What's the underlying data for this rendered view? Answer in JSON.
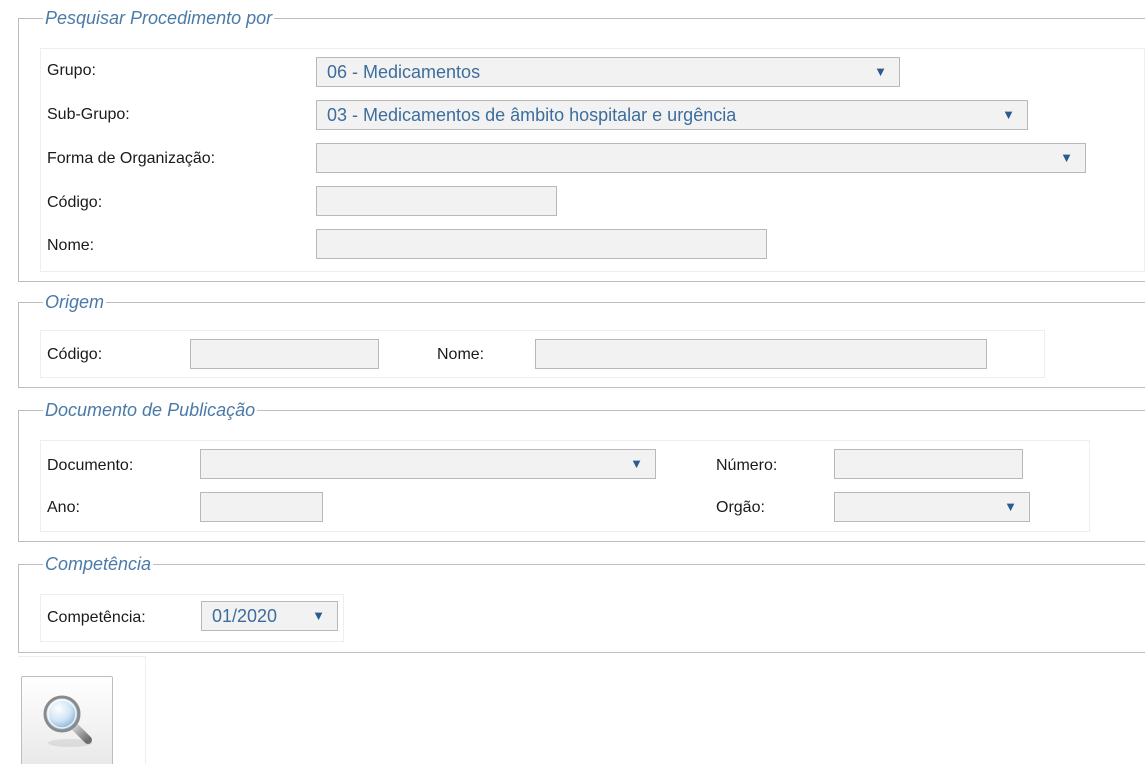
{
  "pesquisar": {
    "legend": "Pesquisar Procedimento por",
    "grupo_label": "Grupo:",
    "grupo_value": "06 - Medicamentos",
    "subgrupo_label": "Sub-Grupo:",
    "subgrupo_value": "03 - Medicamentos de âmbito hospitalar e urgência",
    "forma_label": "Forma de Organização:",
    "forma_value": "",
    "codigo_label": "Código:",
    "codigo_value": "",
    "nome_label": "Nome:",
    "nome_value": ""
  },
  "origem": {
    "legend": "Origem",
    "codigo_label": "Código:",
    "codigo_value": "",
    "nome_label": "Nome:",
    "nome_value": ""
  },
  "documento_publicacao": {
    "legend": "Documento de Publicação",
    "documento_label": "Documento:",
    "documento_value": "",
    "numero_label": "Número:",
    "numero_value": "",
    "ano_label": "Ano:",
    "ano_value": "",
    "orgao_label": "Orgão:",
    "orgao_value": ""
  },
  "competencia": {
    "legend": "Competência",
    "label": "Competência:",
    "value": "01/2020"
  },
  "icons": {
    "dropdown": "chevron-down-icon",
    "search": "magnifier-icon"
  },
  "colors": {
    "legend": "#4a7aa8",
    "select_text": "#3d6d9e",
    "border": "#bdbdbd",
    "field_bg": "#f2f2f2"
  }
}
